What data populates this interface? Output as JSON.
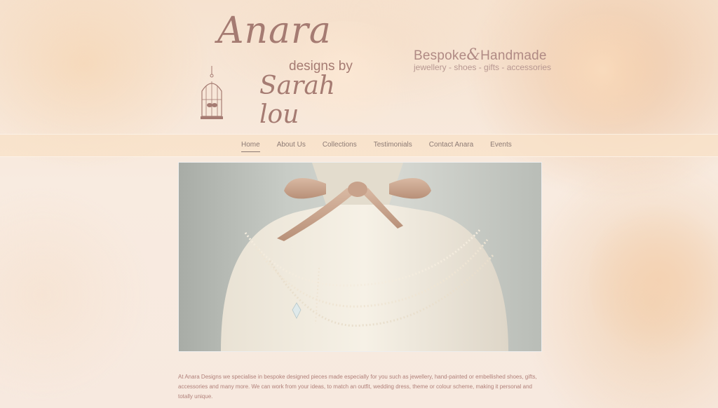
{
  "logo": {
    "anara": "Anara",
    "designs_by": "designs by",
    "sarah_lou": "Sarah lou"
  },
  "tagline": {
    "bespoke": "Bespoke",
    "amp": "&",
    "handmade": "Handmade",
    "categories": "jewellery - shoes - gifts - accessories"
  },
  "nav": {
    "items": [
      {
        "label": "Home"
      },
      {
        "label": "About Us"
      },
      {
        "label": "Collections"
      },
      {
        "label": "Testimonials"
      },
      {
        "label": "Contact Anara"
      },
      {
        "label": "Events"
      }
    ]
  },
  "intro": {
    "text": "At Anara Designs we specialise in bespoke designed pieces made especially for you such as jewellery, hand-painted or embellished shoes, gifts, accessories and many more. We can work from your ideas, to match an outfit, wedding dress, theme or colour scheme, making it personal and totally unique."
  },
  "colors": {
    "logo": "#a57b72",
    "nav_text": "#8c7a74",
    "intro_text": "#b0807a",
    "ribbon": "#c9a58f"
  }
}
